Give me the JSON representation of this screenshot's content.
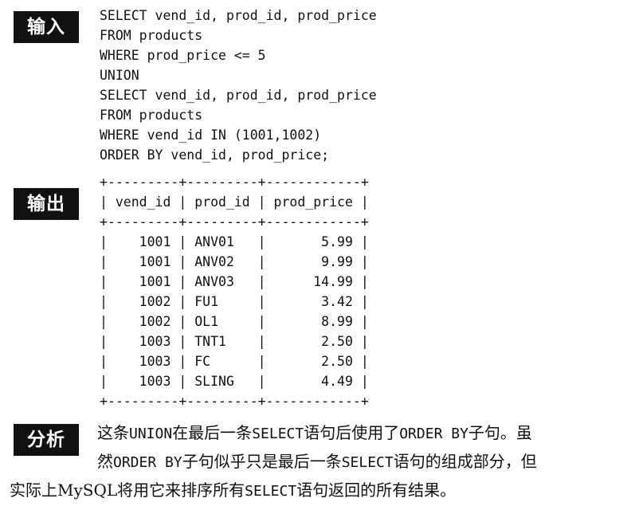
{
  "labels": {
    "input": "输入",
    "output": "输出",
    "analysis": "分析"
  },
  "query_lines": [
    "SELECT vend_id, prod_id, prod_price",
    "FROM products",
    "WHERE prod_price <= 5",
    "UNION",
    "SELECT vend_id, prod_id, prod_price",
    "FROM products",
    "WHERE vend_id IN (1001,1002)",
    "ORDER BY vend_id, prod_price;"
  ],
  "result": {
    "border": "+---------+---------+------------+",
    "header": "| vend_id | prod_id | prod_price |",
    "rows": [
      "|    1001 | ANV01   |       5.99 |",
      "|    1001 | ANV02   |       9.99 |",
      "|    1001 | ANV03   |      14.99 |",
      "|    1002 | FU1     |       3.42 |",
      "|    1002 | OL1     |       8.99 |",
      "|    1003 | TNT1    |       2.50 |",
      "|    1003 | FC      |       2.50 |",
      "|    1003 | SLING   |       4.49 |"
    ]
  },
  "analysis": {
    "line1_a": "这条",
    "line1_b": "UNION",
    "line1_c": "在最后一条",
    "line1_d": "SELECT",
    "line1_e": "语句后使用了",
    "line1_f": "ORDER BY",
    "line1_g": "子句。虽",
    "line2_a": "然",
    "line2_b": "ORDER BY",
    "line2_c": "子句似乎只是最后一条",
    "line2_d": "SELECT",
    "line2_e": "语句的组成部分，但",
    "line3_a": "实际上MySQL将用它来排序所有",
    "line3_b": "SELECT",
    "line3_c": "语句返回的所有结果。"
  }
}
